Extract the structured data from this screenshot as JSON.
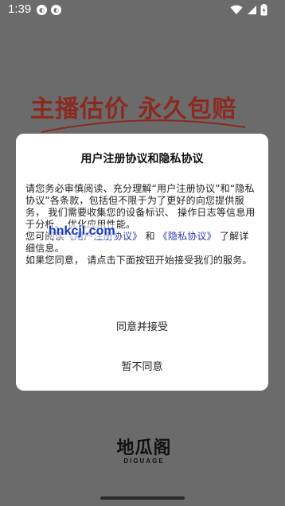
{
  "status_bar": {
    "time": "1:39",
    "notification_1": "◐",
    "notification_2": "◐"
  },
  "hero": {
    "slogan": "主播估价 永久包赔"
  },
  "dialog": {
    "title": "用户注册协议和隐私协议",
    "p1": "请您务必审慎阅读、充分理解“用户注册协议”和“隐私协议”各条款，包括但不限于为了更好的向您提供服务， 我们需要收集您的设备标识、 操作日志等信息用于分析、 优化应用性能。",
    "p2_prefix": "您可阅读",
    "p2_link1": "《用户注册协议》",
    "p2_and": "和",
    "p2_link2": "《隐私协议》",
    "p2_suffix": "了解详细信息。",
    "p3": "如果您同意， 请点击下面按钮开始接受我们的服务。",
    "watermark": "hnkcjl.com",
    "accept_label": "同意并接受",
    "decline_label": "暂不同意"
  },
  "logo": {
    "name": "地瓜阁",
    "sub": "DIGUAGE"
  }
}
